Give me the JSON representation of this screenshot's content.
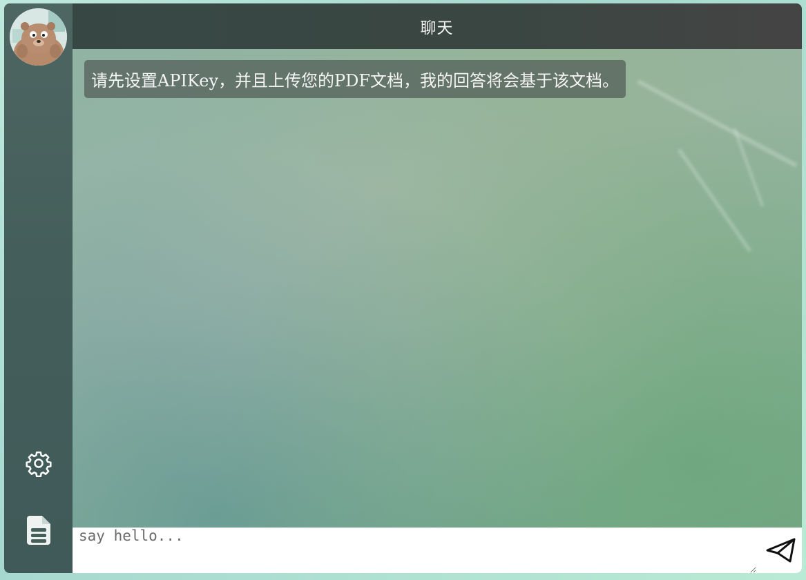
{
  "header": {
    "title": "聊天"
  },
  "sidebar": {
    "avatar_icon": "bear-avatar-icon",
    "items": [
      {
        "icon": "gear-icon",
        "name": "settings"
      },
      {
        "icon": "document-icon",
        "name": "documents"
      }
    ]
  },
  "chat": {
    "messages": [
      {
        "role": "assistant",
        "text": "请先设置APIKey，并且上传您的PDF文档，我的回答将会基于该文档。"
      }
    ]
  },
  "composer": {
    "placeholder": "say hello...",
    "value": "",
    "send_icon": "paper-plane-icon"
  },
  "colors": {
    "sidebar": "#445e5b",
    "header": "#3a4642",
    "bubble": "#505c56",
    "input_bg": "#ffffff"
  }
}
